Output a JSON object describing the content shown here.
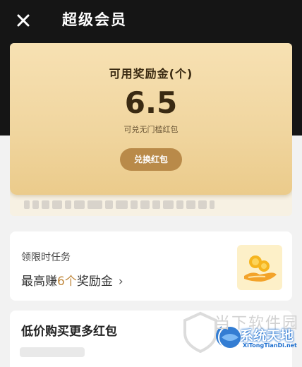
{
  "header": {
    "title": "超级会员",
    "close_icon": "close-icon"
  },
  "reward_card": {
    "title": "可用奖励金(个)",
    "amount": "6.5",
    "subtitle": "可兑无门槛红包",
    "exchange_button": "兑换红包"
  },
  "task_card": {
    "title": "领限时任务",
    "desc_prefix": "最高赚",
    "desc_highlight": "6个",
    "desc_suffix": "奖励金",
    "chevron": "›",
    "icon": "coin-hand-icon"
  },
  "buy_card": {
    "title": "低价购买更多红包"
  },
  "watermark": {
    "ghost_text": "当下软件园",
    "main_text": "系统天地",
    "url": "XiTongTianDi.net"
  },
  "colors": {
    "header_bg": "#151515",
    "card_gold": "#f0d59e",
    "button_brown": "#b98a49",
    "highlight": "#c0883d"
  }
}
